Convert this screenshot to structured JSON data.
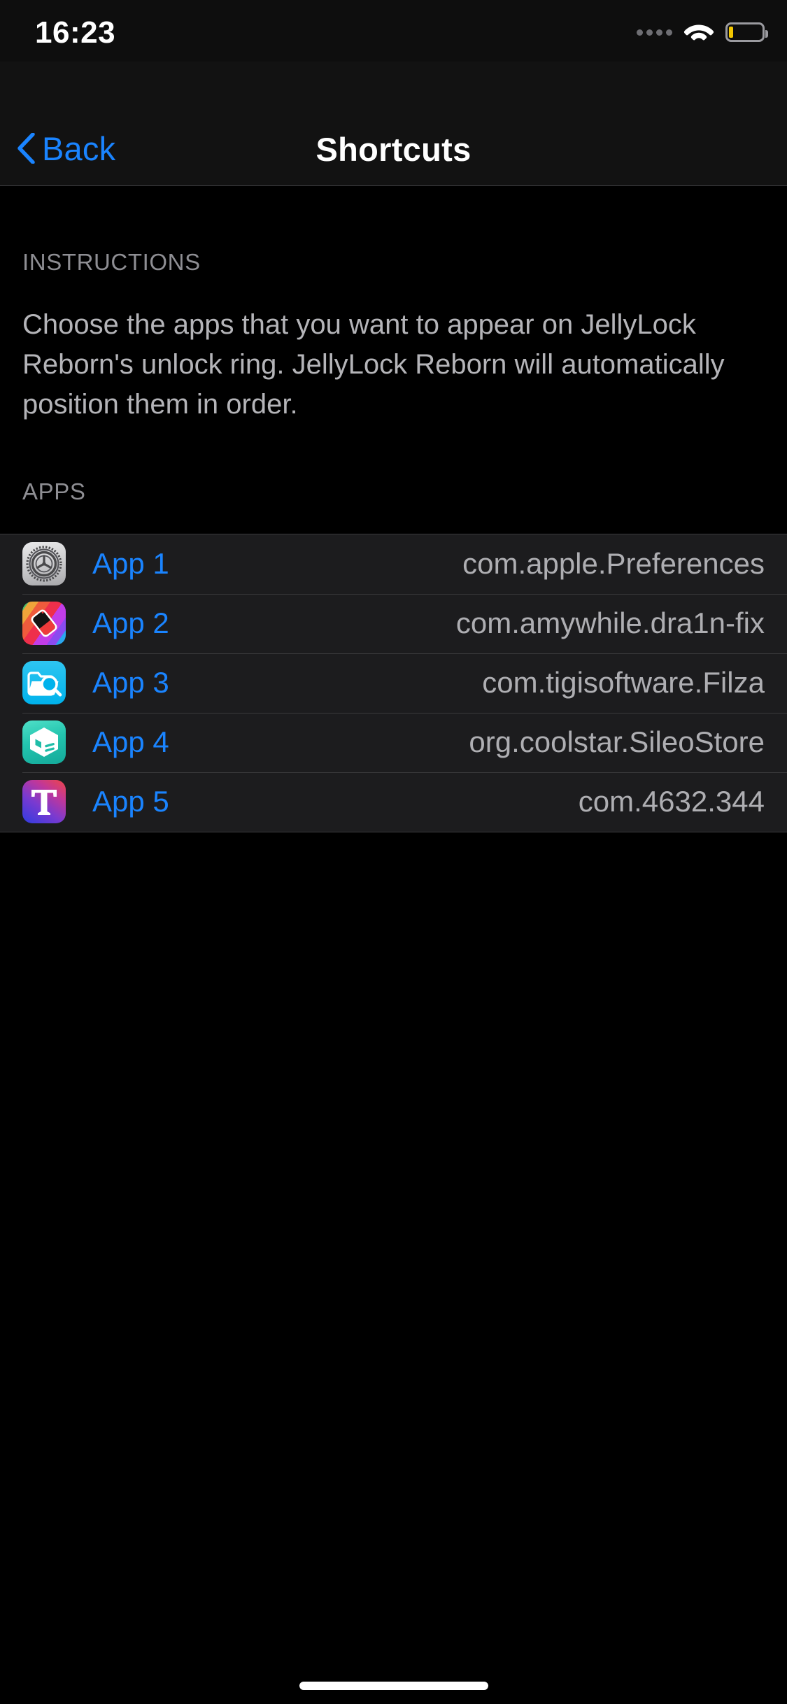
{
  "status_bar": {
    "time": "16:23",
    "signal_icon": "signal-dots-icon",
    "wifi_icon": "wifi-icon",
    "battery_icon": "battery-icon",
    "battery_level_percent": 10,
    "battery_color": "#f2c600"
  },
  "nav": {
    "back_label": "Back",
    "back_icon": "chevron-left-icon",
    "title": "Shortcuts",
    "accent_color": "#1a84ff"
  },
  "instructions": {
    "header": "INSTRUCTIONS",
    "body": "Choose the apps that you want to appear on JellyLock Reborn's unlock ring. JellyLock Reborn will automatically position them in order."
  },
  "apps_section": {
    "header": "APPS",
    "rows": [
      {
        "icon": "settings-gear-icon",
        "title": "App 1",
        "bundle_id": "com.apple.Preferences"
      },
      {
        "icon": "drain-fix-icon",
        "title": "App 2",
        "bundle_id": "com.amywhile.dra1n-fix"
      },
      {
        "icon": "filza-folder-search-icon",
        "title": "App 3",
        "bundle_id": "com.tigisoftware.Filza"
      },
      {
        "icon": "sileo-cube-icon",
        "title": "App 4",
        "bundle_id": "org.coolstar.SileoStore"
      },
      {
        "icon": "letter-t-icon",
        "title": "App 5",
        "bundle_id": "com.4632.344"
      }
    ]
  },
  "home_indicator": {
    "name": "home-indicator"
  }
}
